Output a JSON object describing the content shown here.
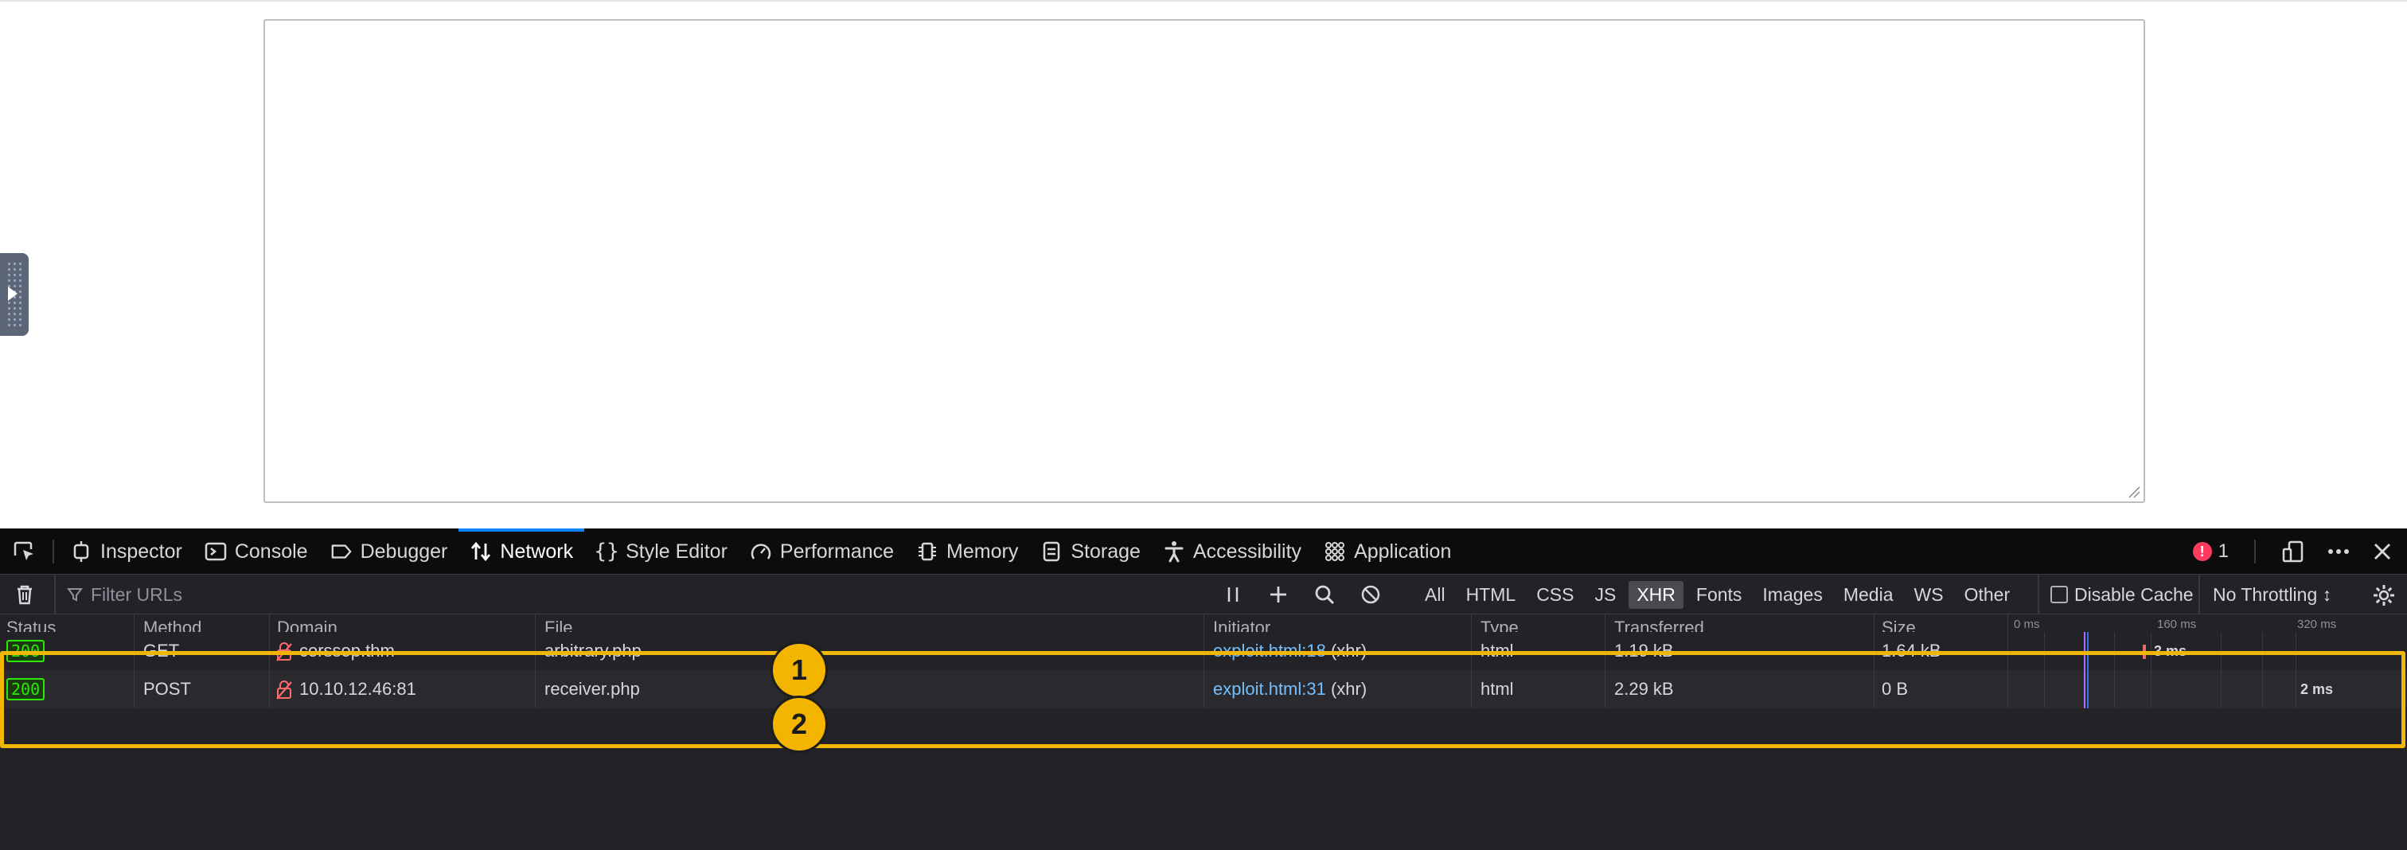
{
  "devtools": {
    "tabs": [
      {
        "label": "Inspector",
        "icon": "inspector-icon"
      },
      {
        "label": "Console",
        "icon": "console-icon"
      },
      {
        "label": "Debugger",
        "icon": "debugger-icon"
      },
      {
        "label": "Network",
        "icon": "network-arrows-icon",
        "selected": true
      },
      {
        "label": "Style Editor",
        "icon": "braces-icon"
      },
      {
        "label": "Performance",
        "icon": "gauge-icon"
      },
      {
        "label": "Memory",
        "icon": "chip-icon"
      },
      {
        "label": "Storage",
        "icon": "storage-icon"
      },
      {
        "label": "Accessibility",
        "icon": "accessibility-icon"
      },
      {
        "label": "Application",
        "icon": "grid-icon"
      }
    ],
    "error_count": "1"
  },
  "network": {
    "filter_placeholder": "Filter URLs",
    "type_filters": [
      "All",
      "HTML",
      "CSS",
      "JS",
      "XHR",
      "Fonts",
      "Images",
      "Media",
      "WS",
      "Other"
    ],
    "active_filter": "XHR",
    "disable_cache_label": "Disable Cache",
    "throttle_label": "No Throttling ↕",
    "columns": [
      "Status",
      "Method",
      "Domain",
      "File",
      "Initiator",
      "Type",
      "Transferred",
      "Size"
    ],
    "waterfall_ticks": [
      "0 ms",
      "160 ms",
      "320 ms"
    ],
    "rows": [
      {
        "status": "200",
        "method": "GET",
        "domain": "corssop.thm",
        "file": "arbitrary.php",
        "initiator_link": "exploit.html:18",
        "initiator_suffix": " (xhr)",
        "type": "html",
        "transferred": "1.19 kB",
        "size": "1.64 kB",
        "timing": "3 ms"
      },
      {
        "status": "200",
        "method": "POST",
        "domain": "10.10.12.46:81",
        "file": "receiver.php",
        "initiator_link": "exploit.html:31",
        "initiator_suffix": " (xhr)",
        "type": "html",
        "transferred": "2.29 kB",
        "size": "0 B",
        "timing": "2 ms"
      }
    ]
  },
  "annotations": {
    "markers": [
      "1",
      "2"
    ],
    "highlight_color": "#f2b705"
  },
  "colors": {
    "accent": "#0a84ff",
    "status_ok": "#30e60b",
    "link": "#75bfff"
  }
}
